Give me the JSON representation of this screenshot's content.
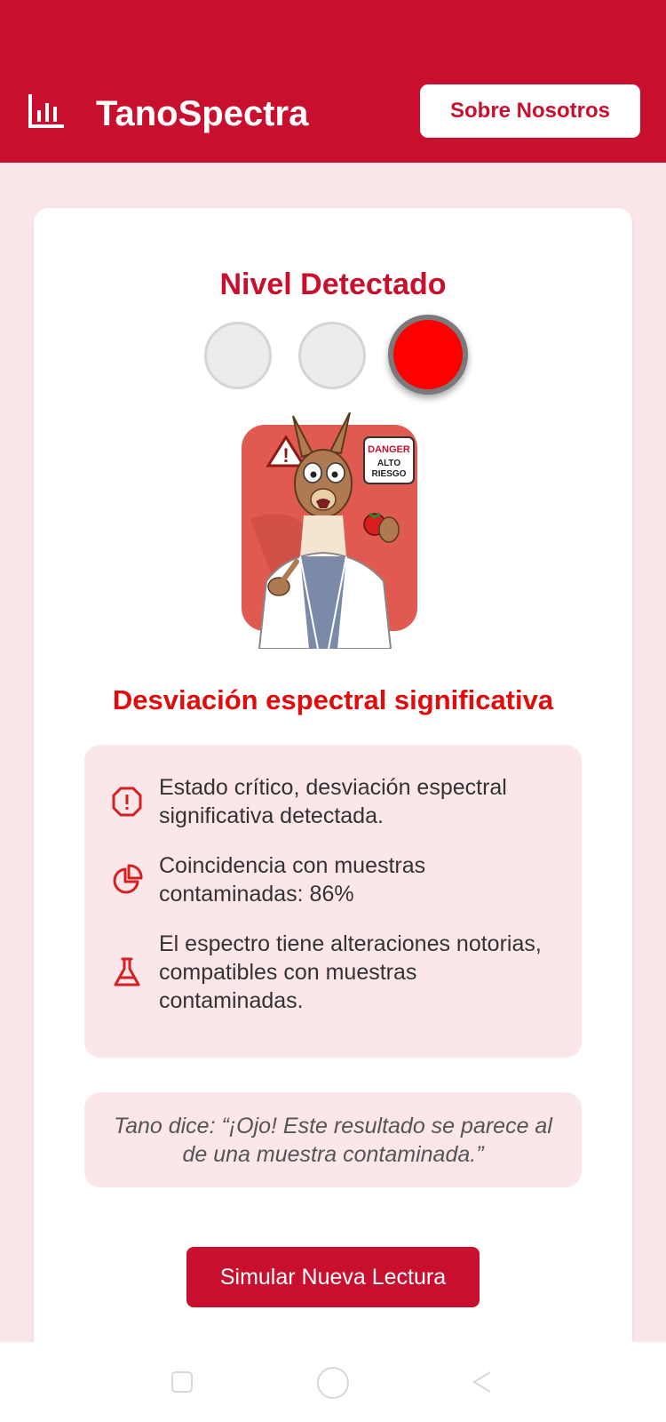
{
  "header": {
    "app_title": "TanoSpectra",
    "about_button": "Sobre Nosotros",
    "logo_icon": "bar-chart-icon",
    "color": "#c8102e"
  },
  "result": {
    "level_title": "Nivel Detectado",
    "traffic_light": {
      "lights": [
        "off",
        "off",
        "on"
      ],
      "active_color": "#ff0000"
    },
    "status_title": "Desviación espectral significativa",
    "details": [
      {
        "icon": "alert-octagon-icon",
        "text": "Estado crítico, desviación espectral significativa detectada."
      },
      {
        "icon": "pie-chart-icon",
        "text": "Coincidencia con muestras contaminadas: 86%"
      },
      {
        "icon": "flask-icon",
        "text": "El espectro tiene alteraciones notorias, compatibles con muestras contaminadas."
      }
    ],
    "quote": "Tano dice: “¡Ojo! Este resultado se parece al de una muestra contaminada.”",
    "mascot": {
      "sign_line1": "DANGER",
      "sign_line2": "ALTO",
      "sign_line3": "RIESGO"
    }
  },
  "actions": {
    "simulate_button": "Simular Nueva Lectura"
  },
  "navbar": {
    "buttons": [
      "recent-apps-icon",
      "home-icon",
      "back-icon"
    ]
  }
}
